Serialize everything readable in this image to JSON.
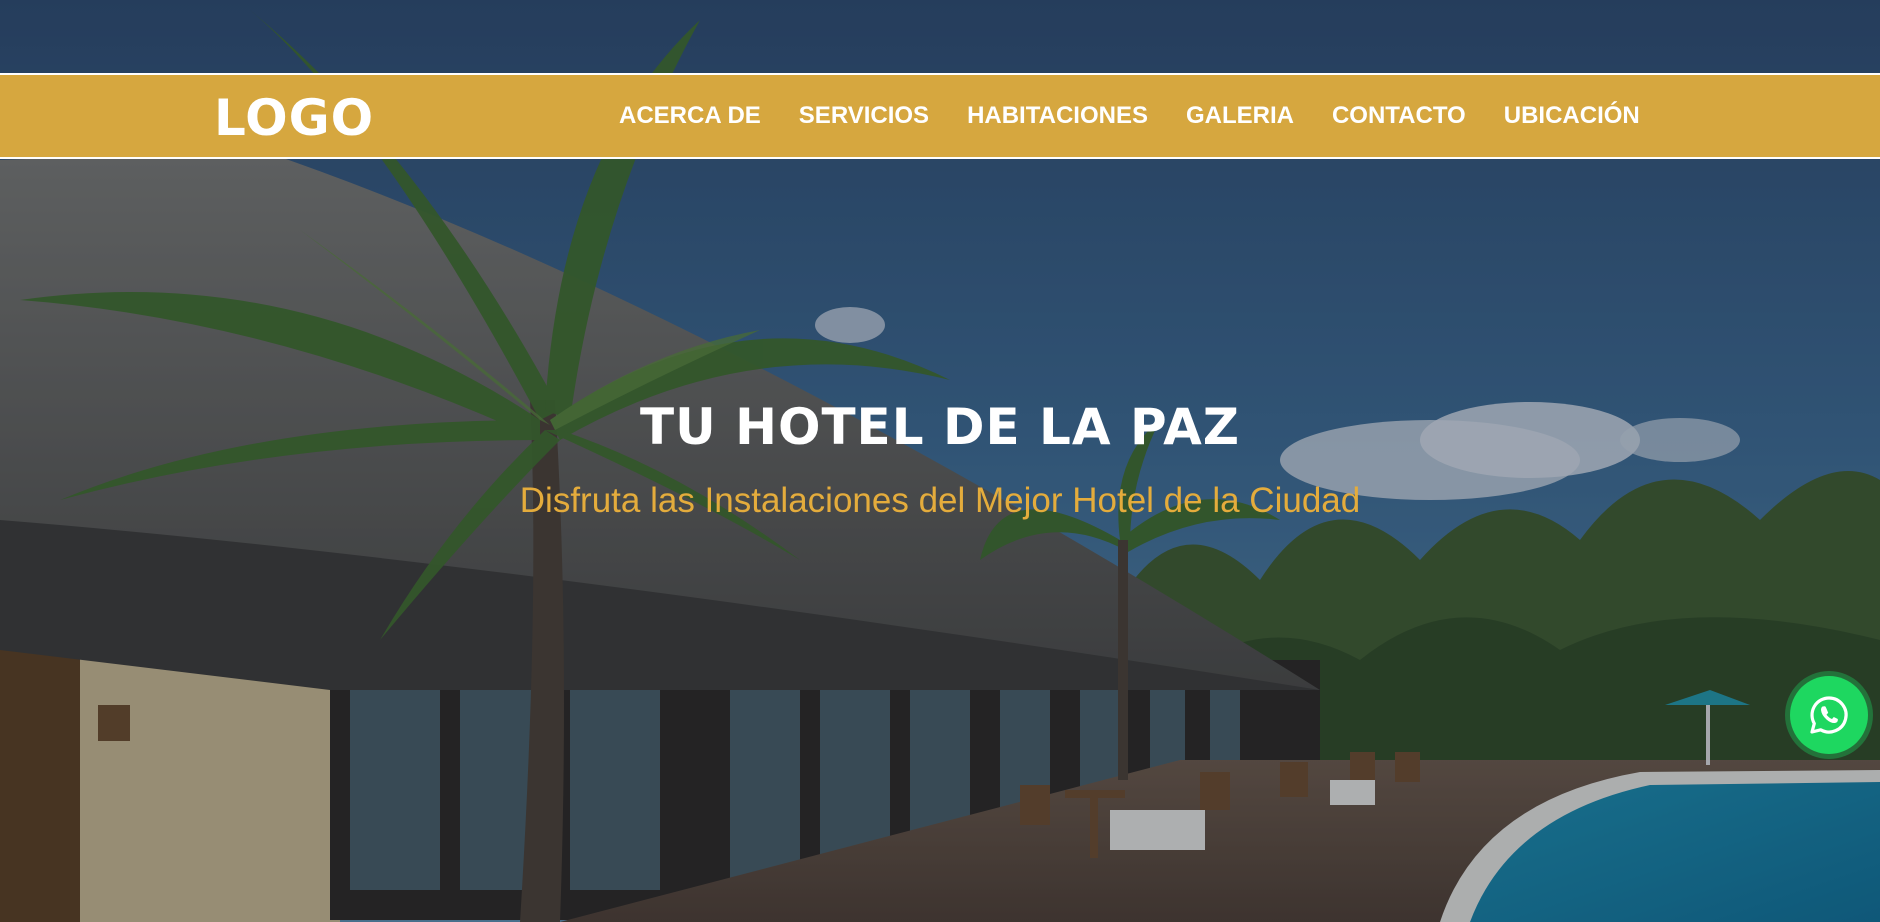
{
  "header": {
    "logo_text": "LOGO",
    "nav": [
      {
        "label": "ACERCA DE"
      },
      {
        "label": "SERVICIOS"
      },
      {
        "label": "HABITACIONES"
      },
      {
        "label": "GALERIA"
      },
      {
        "label": "CONTACTO"
      },
      {
        "label": "UBICACIÓN"
      }
    ]
  },
  "hero": {
    "title": "TU HOTEL DE LA PAZ",
    "subtitle": "Disfruta las Instalaciones del Mejor Hotel de la Ciudad"
  },
  "floating_button": {
    "icon": "whatsapp-icon"
  },
  "colors": {
    "nav_background": "#d6a73f",
    "accent_text": "#e4ac3c",
    "whatsapp_green": "#1ed760"
  }
}
